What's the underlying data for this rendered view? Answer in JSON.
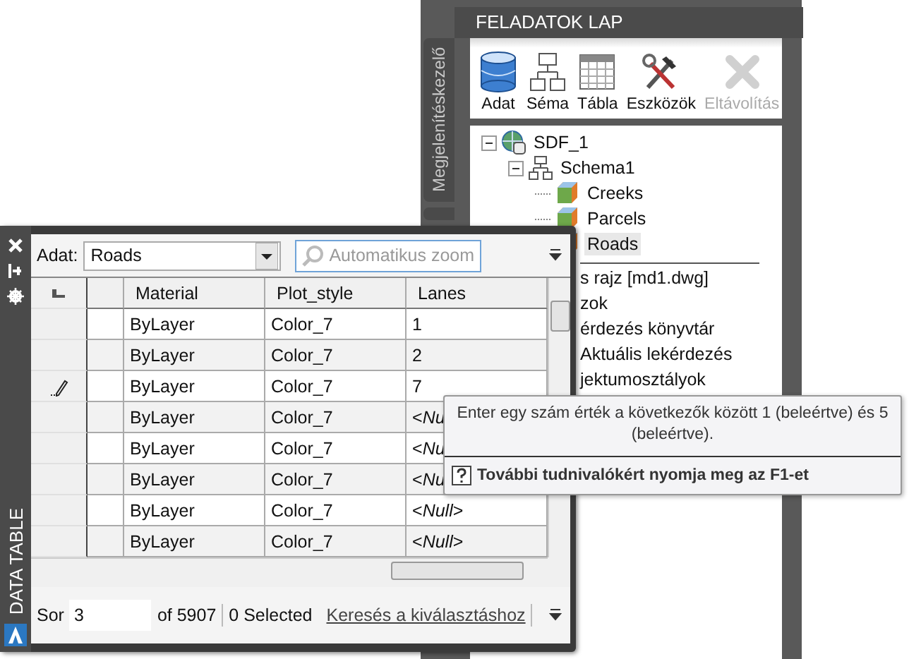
{
  "task_pane": {
    "title": "FELADATOK LAP",
    "side_tab": {
      "label": "Megjelenítéskezelő",
      "selected": false
    },
    "toolbar": [
      {
        "label": "Adat",
        "kind": "database",
        "disabled": false
      },
      {
        "label": "Séma",
        "kind": "schema",
        "disabled": false
      },
      {
        "label": "Tábla",
        "kind": "table",
        "disabled": false
      },
      {
        "label": "Eszközök",
        "kind": "tools",
        "disabled": false
      },
      {
        "label": "Eltávolítás",
        "kind": "remove",
        "disabled": true
      }
    ],
    "tree": [
      {
        "label": "SDF_1",
        "kind": "connection",
        "expanded": true,
        "selected": false,
        "children": [
          {
            "label": "Schema1",
            "kind": "schema",
            "expanded": true,
            "selected": false,
            "children": [
              {
                "label": "Creeks",
                "kind": "feature",
                "selected": false
              },
              {
                "label": "Parcels",
                "kind": "feature",
                "selected": false
              },
              {
                "label": "Roads",
                "kind": "feature",
                "selected": true
              }
            ]
          }
        ]
      }
    ],
    "map_items": [
      "s rajz [md1.dwg]",
      "zok",
      "érdezés könyvtár",
      "Aktuális lekérdezés",
      "jektumosztályok"
    ]
  },
  "data_table": {
    "side_title": "DATA TABLE",
    "source_label": "Adat:",
    "source_value": "Roads",
    "zoom_button": "Automatikus zoom",
    "columns": [
      "Material",
      "Plot_style",
      "Lanes"
    ],
    "rows": [
      {
        "material": "ByLayer",
        "plot_style": "Color_7",
        "lanes": "1",
        "editing": false
      },
      {
        "material": "ByLayer",
        "plot_style": "Color_7",
        "lanes": "2",
        "editing": false
      },
      {
        "material": "ByLayer",
        "plot_style": "Color_7",
        "lanes": "7",
        "editing": true
      },
      {
        "material": "ByLayer",
        "plot_style": "Color_7",
        "lanes": "<*Nu*",
        "editing": false
      },
      {
        "material": "ByLayer",
        "plot_style": "Color_7",
        "lanes": "<*Nu*",
        "editing": false
      },
      {
        "material": "ByLayer",
        "plot_style": "Color_7",
        "lanes": "<*Nu*",
        "editing": false
      },
      {
        "material": "ByLayer",
        "plot_style": "Color_7",
        "lanes": "<*Null*>",
        "editing": false
      },
      {
        "material": "ByLayer",
        "plot_style": "Color_7",
        "lanes": "<*Null*>",
        "editing": false
      }
    ],
    "status": {
      "row_label": "Sor",
      "row_value": "3",
      "of": "of 5907",
      "selected": "0 Selected",
      "link": "Keresés a kiválasztáshoz"
    }
  },
  "tooltip": {
    "text": "Enter egy szám érték a következők között 1 (beleértve) és 5 (beleértve).",
    "help": "További tudnivalókért nyomja meg az F1-et"
  }
}
